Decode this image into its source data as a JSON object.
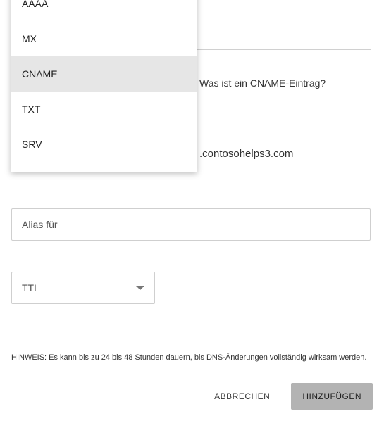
{
  "dropdown": {
    "items": [
      "AAAA",
      "MX",
      "CNAME",
      "TXT",
      "SRV"
    ],
    "highlighted_index": 2
  },
  "help_link": "Was ist ein CNAME-Eintrag?",
  "domain_suffix": ".contosohelps3.com",
  "alias_input": {
    "placeholder": "Alias für",
    "value": ""
  },
  "ttl_select": {
    "label": "TTL"
  },
  "note": "HINWEIS: Es kann bis zu 24 bis 48 Stunden dauern, bis DNS-Änderungen vollständig wirksam werden.",
  "actions": {
    "cancel": "ABBRECHEN",
    "add": "HINZUFÜGEN"
  }
}
